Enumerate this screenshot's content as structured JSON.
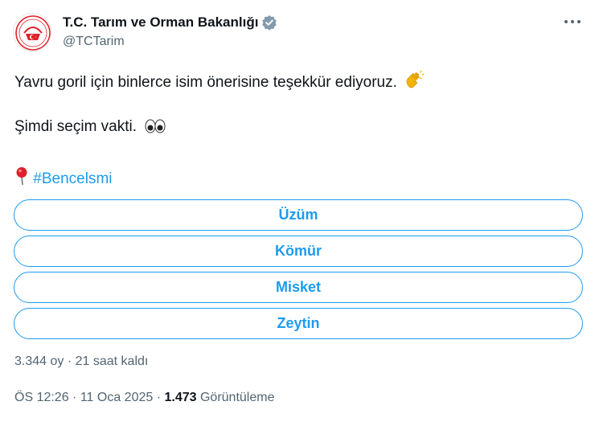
{
  "author": {
    "display_name": "T.C. Tarım ve Orman Bakanlığı",
    "handle": "@TCTarim",
    "verified_icon": "verified-badge-gray"
  },
  "tweet": {
    "line1": "Yavru goril için binlerce isim önerisine teşekkür ediyoruz.",
    "line1_emoji": "clapping-hands",
    "line2": "Şimdi seçim vakti.",
    "line2_emoji": "eyes",
    "line3_icon": "round-pushpin",
    "hashtag": "#Bencelsmi"
  },
  "poll": {
    "options": [
      {
        "label": "Üzüm"
      },
      {
        "label": "Kömür"
      },
      {
        "label": "Misket"
      },
      {
        "label": "Zeytin"
      }
    ],
    "votes": "3.344 oy",
    "separator": " · ",
    "time_left": "21 saat kaldı"
  },
  "meta": {
    "time": "ÖS 12:26",
    "date": "11 Oca 2025",
    "dot": " · ",
    "views_count": "1.473",
    "views_label": "Görüntüleme"
  },
  "colors": {
    "accent": "#1d9bf0",
    "secondary_text": "#536471",
    "primary_text": "#0f1419",
    "logo_red": "#e0202a"
  }
}
